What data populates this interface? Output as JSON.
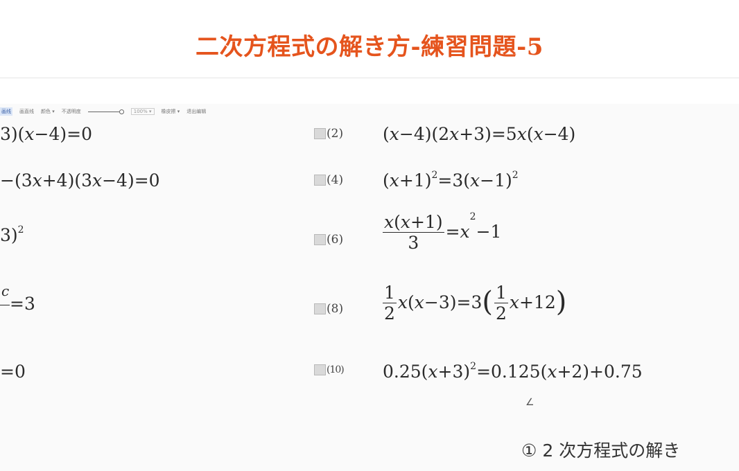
{
  "title": "二次方程式の解き方-練習問題-5",
  "toolbar": {
    "items": [
      "画线",
      "画直线",
      "颜色 ▾",
      "不透明度"
    ],
    "zoom": "100% ▾",
    "eraser": "橡皮擦 ▾",
    "exit": "退出编辑"
  },
  "left_equations": {
    "e1": [
      "3)(",
      "x",
      "−4)=0"
    ],
    "e3": [
      "−(3",
      "x",
      "+4)(3",
      "x",
      "−4)=0"
    ],
    "e5": [
      "3)",
      "2"
    ],
    "e7": [
      "c",
      "=3"
    ],
    "e9": "=0"
  },
  "problems": {
    "p2": {
      "label": "(2)",
      "parts": [
        "(",
        "x",
        "−4)(2",
        "x",
        "+3)=5",
        "x",
        "(",
        "x",
        "−4)"
      ]
    },
    "p4": {
      "label": "(4)",
      "parts": [
        "(",
        "x",
        "+1)",
        "2",
        "=3(",
        "x",
        "−1)",
        "2"
      ]
    },
    "p6": {
      "label": "(6)",
      "num": [
        "x",
        "(",
        "x",
        "+1)"
      ],
      "den": "3",
      "rest": [
        "=",
        "x",
        "2",
        "−1"
      ]
    },
    "p8": {
      "label": "(8)",
      "f1n": "1",
      "f1d": "2",
      "mid": [
        "x",
        "(",
        "x",
        "−3)=3"
      ],
      "lp": "(",
      "f2n": "1",
      "f2d": "2",
      "tail": [
        "x",
        "+12"
      ],
      "rp": ")"
    },
    "p10": {
      "label": "(10)",
      "parts": [
        "0.25(",
        "x",
        "+3)",
        "2",
        "=0.125(",
        "x",
        "+2)+0.75"
      ]
    }
  },
  "cursor_mark": "∠",
  "caption": "① 2 次方程式の解き"
}
